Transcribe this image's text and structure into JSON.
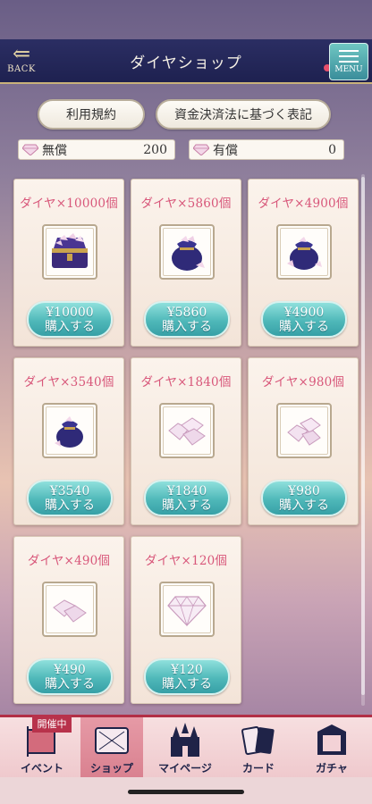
{
  "header": {
    "title": "ダイヤショップ",
    "back_label": "BACK",
    "menu_label": "MENU"
  },
  "buttons": {
    "terms": "利用規約",
    "law": "資金決済法に基づく表記"
  },
  "balance": {
    "free_label": "無償",
    "free_value": "200",
    "paid_label": "有償",
    "paid_value": "0"
  },
  "buy_label": "購入する",
  "products": [
    {
      "name": "ダイヤ×10000個",
      "price": "¥10000",
      "icon": "treasure-chest-icon"
    },
    {
      "name": "ダイヤ×5860個",
      "price": "¥5860",
      "icon": "diamond-bag-icon"
    },
    {
      "name": "ダイヤ×4900個",
      "price": "¥4900",
      "icon": "diamond-bag-icon"
    },
    {
      "name": "ダイヤ×3540個",
      "price": "¥3540",
      "icon": "diamond-bag-icon"
    },
    {
      "name": "ダイヤ×1840個",
      "price": "¥1840",
      "icon": "diamond-pile-icon"
    },
    {
      "name": "ダイヤ×980個",
      "price": "¥980",
      "icon": "diamond-pile-icon"
    },
    {
      "name": "ダイヤ×490個",
      "price": "¥490",
      "icon": "diamond-pair-icon"
    },
    {
      "name": "ダイヤ×120個",
      "price": "¥120",
      "icon": "diamond-icon"
    }
  ],
  "nav": {
    "badge": "開催中",
    "items": [
      "イベント",
      "ショップ",
      "マイページ",
      "カード",
      "ガチャ"
    ],
    "active": "ショップ"
  },
  "colors": {
    "header_bg": "#1e2150",
    "name_text": "#d8577a",
    "buy_button": "#4fb8b9",
    "nav_accent": "#b22f46"
  }
}
